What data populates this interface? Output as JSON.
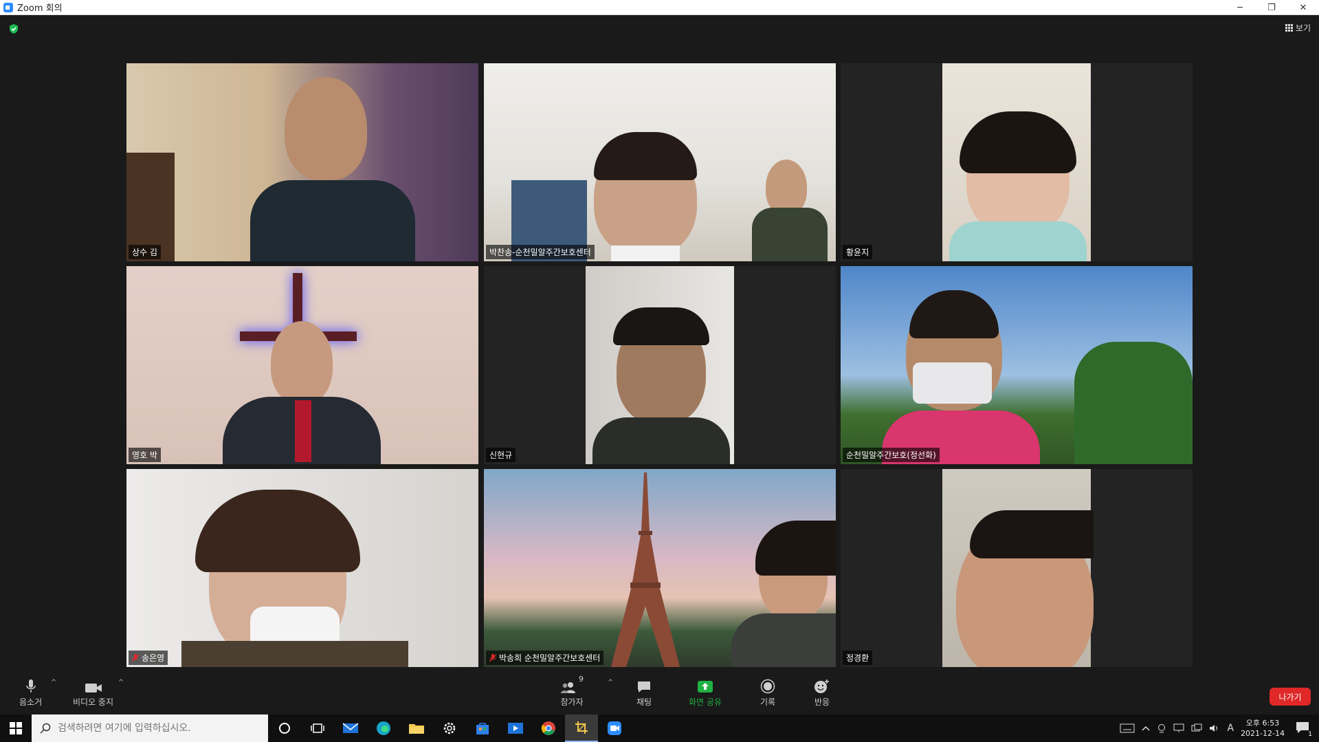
{
  "window": {
    "title": "Zoom 회의",
    "minimize": "─",
    "restore": "❐",
    "close": "✕"
  },
  "top": {
    "view_label": "보기",
    "security_color": "#1db954"
  },
  "participants": [
    {
      "name": "상수 김",
      "active": true,
      "muted": false
    },
    {
      "name": "박찬송-순천밀알주간보호센터",
      "active": false,
      "muted": false
    },
    {
      "name": "황윤지",
      "active": false,
      "muted": false
    },
    {
      "name": "영호 박",
      "active": false,
      "muted": false
    },
    {
      "name": "신현규",
      "active": false,
      "muted": false
    },
    {
      "name": "순천밀알주간보호(정선화)",
      "active": false,
      "muted": false
    },
    {
      "name": "송은영",
      "active": false,
      "muted": true
    },
    {
      "name": "박송희 순천밀알주간보호센터",
      "active": false,
      "muted": true
    },
    {
      "name": "정경환",
      "active": false,
      "muted": false
    }
  ],
  "toolbar": {
    "mute_label": "음소거",
    "video_label": "비디오 중지",
    "participants_label": "참가자",
    "participants_count": "9",
    "chat_label": "채팅",
    "share_label": "화면 공유",
    "record_label": "기록",
    "reactions_label": "반응",
    "leave_label": "나가기",
    "share_color": "#1fb141",
    "leave_color": "#e02828"
  },
  "taskbar": {
    "search_placeholder": "검색하려면 여기에 입력하십시오.",
    "ime": "A",
    "time": "오후 6:53",
    "date": "2021-12-14",
    "notification_count": "1"
  }
}
